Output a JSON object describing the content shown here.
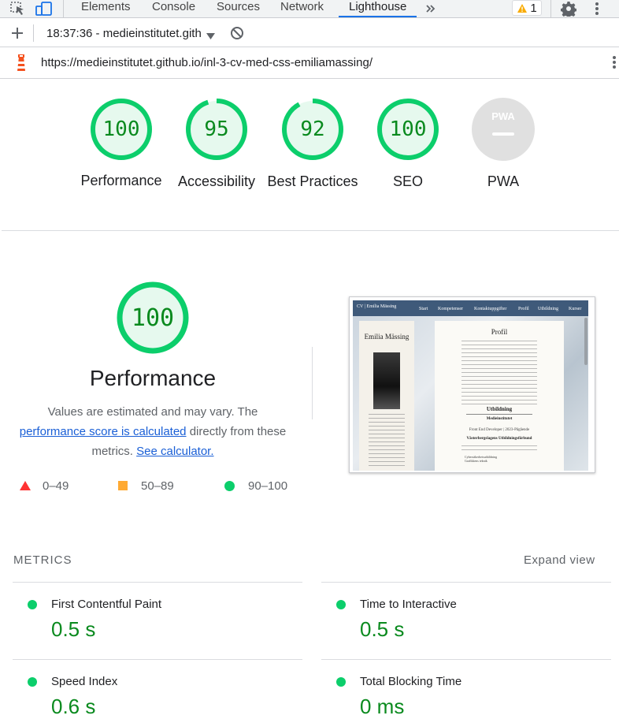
{
  "devtools": {
    "tabs": [
      {
        "label": "Elements"
      },
      {
        "label": "Console"
      },
      {
        "label": "Sources"
      },
      {
        "label": "Network"
      },
      {
        "label": "Lighthouse"
      }
    ],
    "more_tabs_icon": "double-chevron-right-icon",
    "warning_count": "1",
    "report_selector": "18:37:36 - medieinstitutet.gith",
    "url": "https://medieinstitutet.github.io/inl-3-cv-med-css-emiliamassing/"
  },
  "summary_scores": [
    {
      "value": "100",
      "score": 100,
      "label": "Performance"
    },
    {
      "value": "95",
      "score": 95,
      "label": "Accessibility"
    },
    {
      "value": "92",
      "score": 92,
      "label": "Best Practices"
    },
    {
      "value": "100",
      "score": 100,
      "label": "SEO"
    },
    {
      "value": "PWA",
      "score": null,
      "label": "PWA"
    }
  ],
  "performance": {
    "score": "100",
    "title": "Performance",
    "desc_before": "Values are estimated and may vary. The",
    "desc_link": "performance score is calculated",
    "desc_middle": "directly from these metrics.",
    "desc_link2": "See calculator.",
    "legend": [
      {
        "range": "0–49",
        "color": "#ff3333"
      },
      {
        "range": "50–89",
        "color": "#ffaa33"
      },
      {
        "range": "90–100",
        "color": "#0cce6b"
      }
    ]
  },
  "screenshot": {
    "nav_brand": "CV | Emilia Mässing",
    "nav_items": [
      "Start",
      "Kompetenser",
      "Kontaktuppgifter",
      "Profil",
      "Utbildning",
      "Kurser"
    ],
    "name": "Emilia Mässing",
    "profile_heading": "Profil",
    "education_heading": "Utbildning",
    "school": "Medieinstitutet",
    "program": "Front End Developer | 2023-Pågående",
    "school2": "Västerbergslagens Utbildningsförbund",
    "courses": [
      "Cybersäkerhetsutbildning",
      "Grafikkens teknik"
    ]
  },
  "metrics": {
    "header": "METRICS",
    "expand": "Expand view",
    "items": [
      {
        "name": "First Contentful Paint",
        "value": "0.5 s"
      },
      {
        "name": "Time to Interactive",
        "value": "0.5 s"
      },
      {
        "name": "Speed Index",
        "value": "0.6 s"
      },
      {
        "name": "Total Blocking Time",
        "value": "0 ms"
      }
    ]
  },
  "colors": {
    "pass": "#0cce6b",
    "pass_text": "#0a8a1e",
    "pass_bg": "#e6f9ee"
  }
}
